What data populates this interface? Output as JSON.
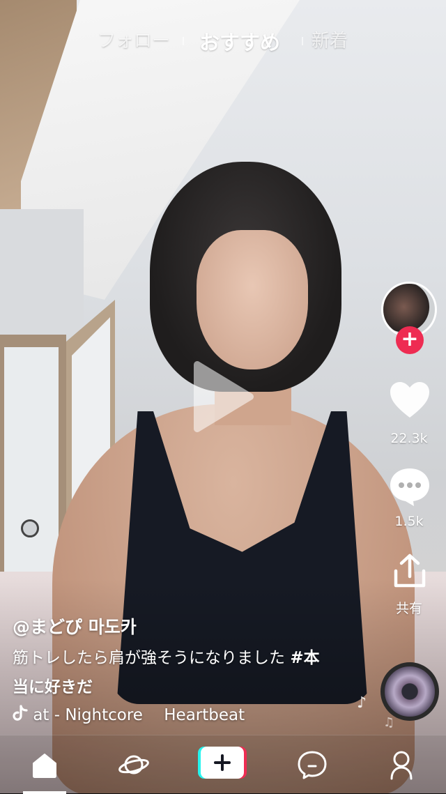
{
  "top_tabs": [
    {
      "label": "フォロー",
      "active": false
    },
    {
      "label": "おすすめ",
      "active": true
    },
    {
      "label": "新着",
      "active": false
    }
  ],
  "side_actions": {
    "likes": "22.3k",
    "comments": "1.5k",
    "share": "共有"
  },
  "post": {
    "username": "@まどぴ 마도카",
    "description_line1": "筋トレしたら肩が強そうになりました",
    "hashtag": "#本",
    "description_line2": "当に好きだ",
    "music_icon": "tiktok-note-icon",
    "music_text": "at - Nightcore　 Heartbeat"
  },
  "bottom_nav": [
    {
      "name": "home",
      "icon": "home-icon",
      "active": true
    },
    {
      "name": "discover",
      "icon": "planet-icon",
      "active": false
    },
    {
      "name": "create",
      "icon": "plus-icon",
      "active": false
    },
    {
      "name": "inbox",
      "icon": "message-icon",
      "active": false
    },
    {
      "name": "profile",
      "icon": "person-icon",
      "active": false
    }
  ],
  "colors": {
    "accent_red": "#ee2c52",
    "accent_cyan": "#25f4ee"
  }
}
